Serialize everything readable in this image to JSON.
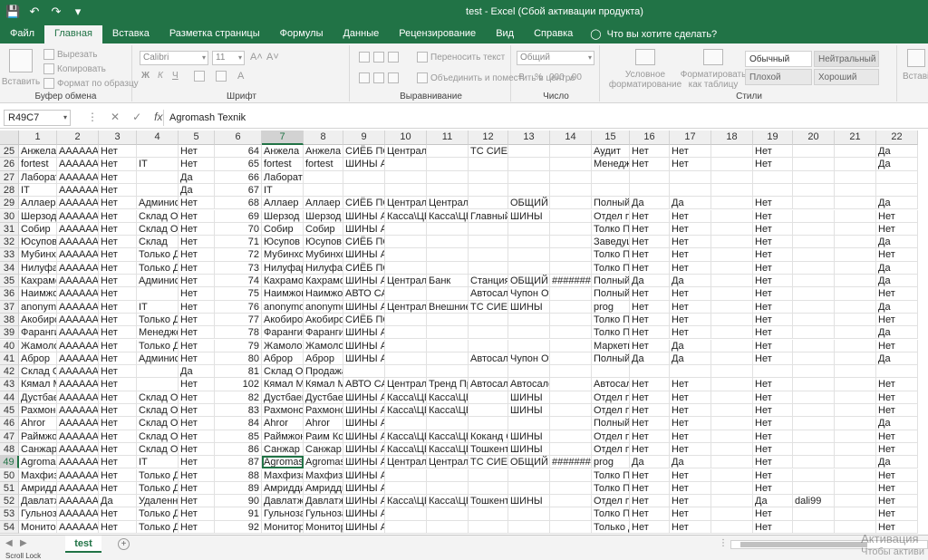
{
  "window": {
    "title": "test  -  Excel (Сбой активации продукта)",
    "qat": {
      "save_icon": "save-icon",
      "undo_icon": "undo-icon",
      "redo_icon": "redo-icon",
      "customize_icon": "customize-icon"
    }
  },
  "tabs": [
    {
      "label": "Файл"
    },
    {
      "label": "Главная"
    },
    {
      "label": "Вставка"
    },
    {
      "label": "Разметка страницы"
    },
    {
      "label": "Формулы"
    },
    {
      "label": "Данные"
    },
    {
      "label": "Рецензирование"
    },
    {
      "label": "Вид"
    },
    {
      "label": "Справка"
    }
  ],
  "tell_me": "Что вы хотите сделать?",
  "ribbon": {
    "clipboard": {
      "label": "Буфер обмена",
      "paste": "Вставить",
      "cut": "Вырезать",
      "copy": "Копировать",
      "format_painter": "Формат по образцу"
    },
    "font": {
      "label": "Шрифт",
      "name": "Calibri",
      "size": "11"
    },
    "alignment": {
      "label": "Выравнивание",
      "wrap": "Переносить текст",
      "merge": "Объединить и поместить в центре"
    },
    "number": {
      "label": "Число",
      "format": "Общий"
    },
    "styles": {
      "label": "Стили",
      "cond_format": "Условное форматирование",
      "as_table": "Форматировать как таблицу",
      "normal": "Обычный",
      "neutral": "Нейтральный",
      "bad": "Плохой",
      "good": "Хороший"
    },
    "cells": {
      "insert": "Вставі"
    }
  },
  "formula_bar": {
    "name_box": "R49C7",
    "content": "Agromash Texnik"
  },
  "columns": [
    "1",
    "2",
    "3",
    "4",
    "5",
    "6",
    "7",
    "8",
    "9",
    "10",
    "11",
    "12",
    "13",
    "14",
    "15",
    "16",
    "17",
    "18",
    "19",
    "20",
    "21",
    "22"
  ],
  "selected": {
    "row": "49",
    "col": "7"
  },
  "rows": [
    {
      "n": "25",
      "c": [
        "Анжела",
        "AAAAAAB",
        "Нет",
        "",
        "Нет",
        "64",
        "Анжела",
        "Анжела",
        "СИЁБ ПОС",
        "Центральная касса",
        "",
        "ТС СИЕБ ШАВКАТ ОРЗУ",
        "",
        "",
        "Аудит",
        "Нет",
        "Нет",
        "",
        "Нет",
        "",
        "",
        "Да"
      ]
    },
    {
      "n": "26",
      "c": [
        "fortest",
        "AAAAAAB",
        "Нет",
        "IT",
        "Нет",
        "65",
        "fortest",
        "fortest",
        "ШИНЫ АГРОМАШ",
        "",
        "",
        "",
        "",
        "",
        "Менедже",
        "Нет",
        "Нет",
        "",
        "Нет",
        "",
        "",
        "Да"
      ]
    },
    {
      "n": "27",
      "c": [
        "Лаборато",
        "AAAAAAB",
        "Нет",
        "",
        "Да",
        "66",
        "Лаборатория",
        "",
        "",
        "",
        "",
        "",
        "",
        "",
        "",
        "",
        "",
        "",
        "",
        "",
        "",
        ""
      ]
    },
    {
      "n": "28",
      "c": [
        "IT",
        "AAAAAAB",
        "Нет",
        "",
        "Да",
        "67",
        "IT",
        "",
        "",
        "",
        "",
        "",
        "",
        "",
        "",
        "",
        "",
        "",
        "",
        "",
        "",
        ""
      ]
    },
    {
      "n": "29",
      "c": [
        "Аллаер",
        "AAAAAAB",
        "Нет",
        "Админист",
        "Нет",
        "68",
        "Аллаер",
        "Аллаер",
        "СИЁБ ПОС",
        "Централь",
        "Центральная касса",
        "",
        "ОБЩИЙ ПРОЧИЕ",
        "",
        "Полный д",
        "Да",
        "Да",
        "",
        "Нет",
        "",
        "",
        "Да"
      ]
    },
    {
      "n": "30",
      "c": [
        "Шерзод Х",
        "AAAAAAB",
        "Нет",
        "Склад Отд",
        "Нет",
        "69",
        "Шерзод Х",
        "Шерзод Х",
        "ШИНЫ АГ",
        "Касса\\ЦЕН",
        "Касса\\ЦЕН",
        "Главный с",
        "ШИНЫ",
        "",
        "Отдел про",
        "Нет",
        "Нет",
        "",
        "Нет",
        "",
        "",
        "Нет"
      ]
    },
    {
      "n": "31",
      "c": [
        "Собир",
        "AAAAAAB",
        "Нет",
        "Склад Отд",
        "Нет",
        "70",
        "Собир",
        "Собир",
        "ШИНЫ АГРОМАШ",
        "",
        "",
        "",
        "",
        "",
        "Толко Про",
        "Нет",
        "Нет",
        "",
        "Нет",
        "",
        "",
        "Нет"
      ]
    },
    {
      "n": "32",
      "c": [
        "Юсупов Ж",
        "AAAAAAB",
        "Нет",
        "Склад",
        "Нет",
        "71",
        "Юсупов Ж",
        "Юсупов Ж",
        "СИЁБ ПОСТАВКИ",
        "",
        "",
        "",
        "",
        "",
        "Заведущи",
        "Нет",
        "Нет",
        "",
        "Нет",
        "",
        "",
        "Да"
      ]
    },
    {
      "n": "33",
      "c": [
        "Мубинхо",
        "AAAAAAB",
        "Нет",
        "Только Д",
        "Нет",
        "72",
        "Мубинхо",
        "Мубинхо",
        "ШИНЫ АГРОМАШ",
        "",
        "",
        "",
        "",
        "",
        "Толко Про",
        "Нет",
        "Нет",
        "",
        "Нет",
        "",
        "",
        "Нет"
      ]
    },
    {
      "n": "34",
      "c": [
        "Нилуфар",
        "AAAAAAB",
        "Нет",
        "Только Д",
        "Нет",
        "73",
        "Нилуфар",
        "Нилуфар",
        "СИЁБ ПОСТАВКИ",
        "",
        "",
        "",
        "",
        "",
        "Толко Про",
        "Нет",
        "Нет",
        "",
        "Нет",
        "",
        "",
        "Да"
      ]
    },
    {
      "n": "35",
      "c": [
        "Кахрамон",
        "AAAAAAB",
        "Нет",
        "Админист",
        "Нет",
        "74",
        "Кахрамон",
        "Кахрамон",
        "ШИНЫ АГ",
        "Централь",
        "Банк",
        "Станция З",
        "ОБЩИЙ П",
        "#########",
        "Полный",
        "Да",
        "Да",
        "",
        "Нет",
        "",
        "",
        "Да"
      ]
    },
    {
      "n": "36",
      "c": [
        "Наимжон",
        "AAAAAAB",
        "Нет",
        "",
        "Нет",
        "75",
        "Наимжон",
        "Наимжон",
        "АВТО САЛОН ТРЕНД МОТОР",
        "",
        "",
        "Автосалон",
        "Чупон Ота",
        "",
        "Полный",
        "Нет",
        "Нет",
        "",
        "Нет",
        "",
        "",
        "Нет"
      ]
    },
    {
      "n": "37",
      "c": [
        "anonymo",
        "AAAAAAB",
        "Нет",
        "IT",
        "Нет",
        "76",
        "anonymo",
        "anonymo",
        "ШИНЫ АГ",
        "Централь",
        "Внешние",
        "ТС СИЕБ Ш",
        "ШИНЫ",
        "",
        "prog",
        "Нет",
        "Нет",
        "",
        "Нет",
        "",
        "",
        "Да"
      ]
    },
    {
      "n": "38",
      "c": [
        "Акобиров",
        "AAAAAAB",
        "Нет",
        "Только Д",
        "Нет",
        "77",
        "Акобиров",
        "Акобиров",
        "СИЁБ ПОСТАВКИ",
        "",
        "",
        "",
        "",
        "",
        "Толко Про",
        "Нет",
        "Нет",
        "",
        "Нет",
        "",
        "",
        "Нет"
      ]
    },
    {
      "n": "39",
      "c": [
        "Фарангиз",
        "AAAAAAB",
        "Нет",
        "Менеджер",
        "Нет",
        "78",
        "Фарангиз",
        "Фарангиз",
        "ШИНЫ АГРОМАШ",
        "",
        "",
        "",
        "",
        "",
        "Толко Про",
        "Нет",
        "Нет",
        "",
        "Нет",
        "",
        "",
        "Да"
      ]
    },
    {
      "n": "40",
      "c": [
        "Жамолов",
        "AAAAAAB",
        "Нет",
        "Только Д",
        "Нет",
        "79",
        "Жамолов",
        "Жамолов",
        "ШИНЫ АГРОМАШ",
        "",
        "",
        "",
        "",
        "",
        "Маркетин",
        "Нет",
        "Да",
        "",
        "Нет",
        "",
        "",
        "Нет"
      ]
    },
    {
      "n": "41",
      "c": [
        "Аброр",
        "AAAAAAB",
        "Нет",
        "Админист",
        "Нет",
        "80",
        "Аброр",
        "Аброр",
        "ШИНЫ АГРОМАШ",
        "",
        "",
        "Автосалон",
        "Чупон Ота",
        "",
        "Полный д",
        "Да",
        "Да",
        "",
        "Нет",
        "",
        "",
        "Да"
      ]
    },
    {
      "n": "42",
      "c": [
        "Склад Отд",
        "AAAAAAB",
        "Нет",
        "",
        "Да",
        "81",
        "Склад Отд",
        "Продажа",
        "",
        "",
        "",
        "",
        "",
        "",
        "",
        "",
        "",
        "",
        "",
        "",
        "",
        ""
      ]
    },
    {
      "n": "43",
      "c": [
        "Кямал Му",
        "AAAAAAB",
        "Нет",
        "",
        "Нет",
        "102",
        "Кямал Му",
        "Кямал Му",
        "АВТО САЛ",
        "Централь",
        "Тренд Пр",
        "Автосалон",
        "Автосалон",
        "",
        "Автосало",
        "Нет",
        "Нет",
        "",
        "Нет",
        "",
        "",
        "Нет"
      ]
    },
    {
      "n": "44",
      "c": [
        "Дустбаев",
        "AAAAAAB",
        "Нет",
        "Склад Отд",
        "Нет",
        "82",
        "Дустбаев",
        "Дустбаев",
        "ШИНЫ АГ",
        "Касса\\ЦЕН",
        "Касса\\ЦЕНТР",
        "",
        "ШИНЫ",
        "",
        "Отдел про",
        "Нет",
        "Нет",
        "",
        "Нет",
        "",
        "",
        "Нет"
      ]
    },
    {
      "n": "45",
      "c": [
        "Рахмоное",
        "AAAAAAB",
        "Нет",
        "Склад Отд",
        "Нет",
        "83",
        "Рахмоное",
        "Рахмоное",
        "ШИНЫ АГ",
        "Касса\\ЦЕН",
        "Касса\\ЦЕНТР",
        "",
        "ШИНЫ",
        "",
        "Отдел про",
        "Нет",
        "Нет",
        "",
        "Нет",
        "",
        "",
        "Нет"
      ]
    },
    {
      "n": "46",
      "c": [
        "Ahror",
        "AAAAAAB",
        "Нет",
        "Склад Отд",
        "Нет",
        "84",
        "Ahror",
        "Ahror",
        "ШИНЫ АГРОМАШ",
        "",
        "",
        "",
        "",
        "",
        "Полный",
        "Нет",
        "Нет",
        "",
        "Нет",
        "",
        "",
        "Да"
      ]
    },
    {
      "n": "47",
      "c": [
        "Раймжон",
        "AAAAAAB",
        "Нет",
        "Склад Отд",
        "Нет",
        "85",
        "Раймжон",
        "Раим Кок",
        "ШИНЫ АГ",
        "Касса\\ЦЕН",
        "Касса\\ЦЕН",
        "Коканд С",
        "ШИНЫ",
        "",
        "Отдел про",
        "Нет",
        "Нет",
        "",
        "Нет",
        "",
        "",
        "Нет"
      ]
    },
    {
      "n": "48",
      "c": [
        "Санжар Т",
        "AAAAAAB",
        "Нет",
        "Склад Отд",
        "Нет",
        "86",
        "Санжар Т",
        "Санжар Т",
        "ШИНЫ АГ",
        "Касса\\ЦЕН",
        "Касса\\ЦЕН",
        "Тошкент С",
        "ШИНЫ",
        "",
        "Отдел про",
        "Нет",
        "Нет",
        "",
        "Нет",
        "",
        "",
        "Нет"
      ]
    },
    {
      "n": "49",
      "c": [
        "Agromash",
        "AAAAAAB",
        "Нет",
        "IT",
        "Нет",
        "87",
        "Agromash",
        "Agromash",
        "ШИНЫ АГ",
        "Централь",
        "Централь",
        "ТС СИЕБ Ш",
        "ОБЩИЙ П",
        "#########",
        "prog",
        "Да",
        "Да",
        "",
        "Нет",
        "",
        "",
        "Да"
      ]
    },
    {
      "n": "50",
      "c": [
        "Махфиза",
        "AAAAAAB",
        "Нет",
        "Только Д",
        "Нет",
        "88",
        "Махфиза",
        "Махфиза",
        "ШИНЫ АГРОМАШ",
        "",
        "",
        "",
        "",
        "",
        "Толко Про",
        "Нет",
        "Нет",
        "",
        "Нет",
        "",
        "",
        "Нет"
      ]
    },
    {
      "n": "51",
      "c": [
        "Амриддин",
        "AAAAAAB",
        "Нет",
        "Только Д",
        "Нет",
        "89",
        "Амриддин",
        "Амриддин",
        "ШИНЫ АГРОМАШ",
        "",
        "",
        "",
        "",
        "",
        "Толко Про",
        "Нет",
        "Нет",
        "",
        "Нет",
        "",
        "",
        "Нет"
      ]
    },
    {
      "n": "52",
      "c": [
        "Давлатжо",
        "AAAAAAB",
        "Да",
        "Удаленны",
        "Нет",
        "90",
        "Давлатжо",
        "Давлатжо",
        "ШИНЫ АГ",
        "Касса\\ЦЕН",
        "Касса\\ЦЕН",
        "Тошкент С",
        "ШИНЫ",
        "",
        "Отдел про",
        "Нет",
        "Нет",
        "",
        "Да",
        "dali99",
        "",
        "Нет"
      ]
    },
    {
      "n": "53",
      "c": [
        "Гульноза",
        "AAAAAAB",
        "Нет",
        "Только Д",
        "Нет",
        "91",
        "Гульноза",
        "Гульноза",
        "ШИНЫ АГРОМАШ",
        "",
        "",
        "",
        "",
        "",
        "Толко Про",
        "Нет",
        "Нет",
        "",
        "Нет",
        "",
        "",
        "Нет"
      ]
    },
    {
      "n": "54",
      "c": [
        "Мониторо",
        "AAAAAAB",
        "Нет",
        "Только Д",
        "Нет",
        "92",
        "Мониторо",
        "Мониторо",
        "ШИНЫ АГРОМАШ",
        "",
        "",
        "",
        "",
        "",
        "Только д",
        "Нет",
        "Нет",
        "",
        "Нет",
        "",
        "",
        "Нет"
      ]
    }
  ],
  "sheet_tabs": [
    {
      "label": "test"
    }
  ],
  "status": {
    "text": "Scroll Lock"
  },
  "activation": {
    "line1": "Активация",
    "line2": "Чтобы активи"
  },
  "colors": {
    "accent": "#217346"
  }
}
